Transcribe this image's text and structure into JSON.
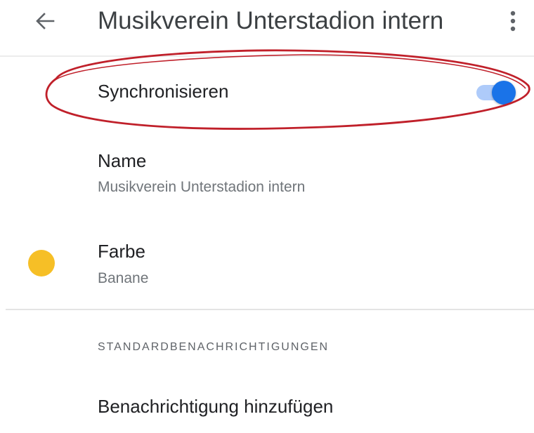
{
  "appbar": {
    "back_icon": "arrow-back-icon",
    "title": "Musikverein Unterstadion intern",
    "more_icon": "more-vert-icon"
  },
  "settings": {
    "sync": {
      "label": "Synchronisieren",
      "enabled": true,
      "accent_color": "#1a73e8"
    },
    "name": {
      "label": "Name",
      "value": "Musikverein Unterstadion intern"
    },
    "color": {
      "label": "Farbe",
      "value": "Banane",
      "swatch": "#f6bf26"
    }
  },
  "notifications": {
    "section_header": "STANDARDBENACHRICHTIGUNGEN",
    "add_label": "Benachrichtigung hinzufügen"
  },
  "annotation": {
    "shape": "ellipse",
    "color": "#c0202a"
  }
}
